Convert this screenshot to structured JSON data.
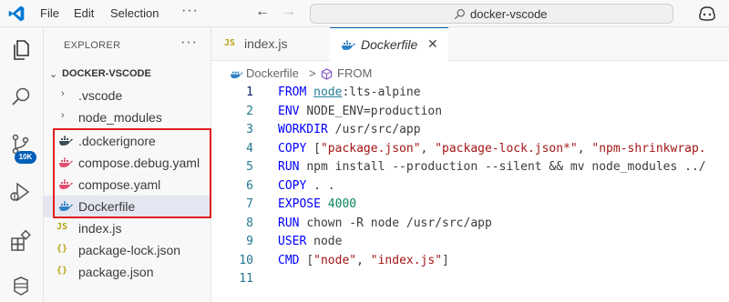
{
  "menu": {
    "file": "File",
    "edit": "Edit",
    "selection": "Selection",
    "more": "···"
  },
  "search": {
    "text": "docker-vscode"
  },
  "activity": {
    "badge": "10K"
  },
  "explorer": {
    "title": "EXPLORER",
    "more": "···",
    "root": "DOCKER-VSCODE",
    "items": [
      {
        "label": ".vscode",
        "type": "folder"
      },
      {
        "label": "node_modules",
        "type": "folder"
      },
      {
        "label": ".dockerignore",
        "type": "docker"
      },
      {
        "label": "compose.debug.yaml",
        "type": "compose"
      },
      {
        "label": "compose.yaml",
        "type": "compose"
      },
      {
        "label": "Dockerfile",
        "type": "docker",
        "selected": true
      },
      {
        "label": "index.js",
        "type": "js",
        "badge": "JS"
      },
      {
        "label": "package-lock.json",
        "type": "json",
        "badge": "{}"
      },
      {
        "label": "package.json",
        "type": "json",
        "badge": "{}"
      }
    ]
  },
  "tabs": [
    {
      "label": "index.js",
      "badge": "JS"
    },
    {
      "label": "Dockerfile",
      "active": true,
      "close": "✕"
    }
  ],
  "breadcrumb": {
    "file": "Dockerfile",
    "sep": ">",
    "symbol": "FROM"
  },
  "code": {
    "lines": [
      {
        "n": "1",
        "parts": [
          {
            "c": "kw",
            "t": "FROM "
          },
          {
            "c": "ref",
            "t": "node"
          },
          {
            "c": "plain",
            "t": ":lts-alpine"
          }
        ]
      },
      {
        "n": "2",
        "parts": [
          {
            "c": "kw",
            "t": "ENV "
          },
          {
            "c": "plain",
            "t": "NODE_ENV=production"
          }
        ]
      },
      {
        "n": "3",
        "parts": [
          {
            "c": "kw",
            "t": "WORKDIR "
          },
          {
            "c": "plain",
            "t": "/usr/src/app"
          }
        ]
      },
      {
        "n": "4",
        "parts": [
          {
            "c": "kw",
            "t": "COPY "
          },
          {
            "c": "plain",
            "t": "["
          },
          {
            "c": "str",
            "t": "\"package.json\""
          },
          {
            "c": "plain",
            "t": ", "
          },
          {
            "c": "str",
            "t": "\"package-lock.json*\""
          },
          {
            "c": "plain",
            "t": ", "
          },
          {
            "c": "str",
            "t": "\"npm-shrinkwrap."
          }
        ]
      },
      {
        "n": "5",
        "parts": [
          {
            "c": "kw",
            "t": "RUN "
          },
          {
            "c": "plain",
            "t": "npm install --production --silent && mv node_modules ../"
          }
        ]
      },
      {
        "n": "6",
        "parts": [
          {
            "c": "kw",
            "t": "COPY "
          },
          {
            "c": "plain",
            "t": ". ."
          }
        ]
      },
      {
        "n": "7",
        "parts": [
          {
            "c": "kw",
            "t": "EXPOSE "
          },
          {
            "c": "num",
            "t": "4000"
          }
        ]
      },
      {
        "n": "8",
        "parts": [
          {
            "c": "kw",
            "t": "RUN "
          },
          {
            "c": "plain",
            "t": "chown -R node /usr/src/app"
          }
        ]
      },
      {
        "n": "9",
        "parts": [
          {
            "c": "kw",
            "t": "USER "
          },
          {
            "c": "plain",
            "t": "node"
          }
        ]
      },
      {
        "n": "10",
        "parts": [
          {
            "c": "kw",
            "t": "CMD "
          },
          {
            "c": "plain",
            "t": "["
          },
          {
            "c": "str",
            "t": "\"node\""
          },
          {
            "c": "plain",
            "t": ", "
          },
          {
            "c": "str",
            "t": "\"index.js\""
          },
          {
            "c": "plain",
            "t": "]"
          }
        ]
      },
      {
        "n": "11",
        "parts": []
      }
    ]
  }
}
